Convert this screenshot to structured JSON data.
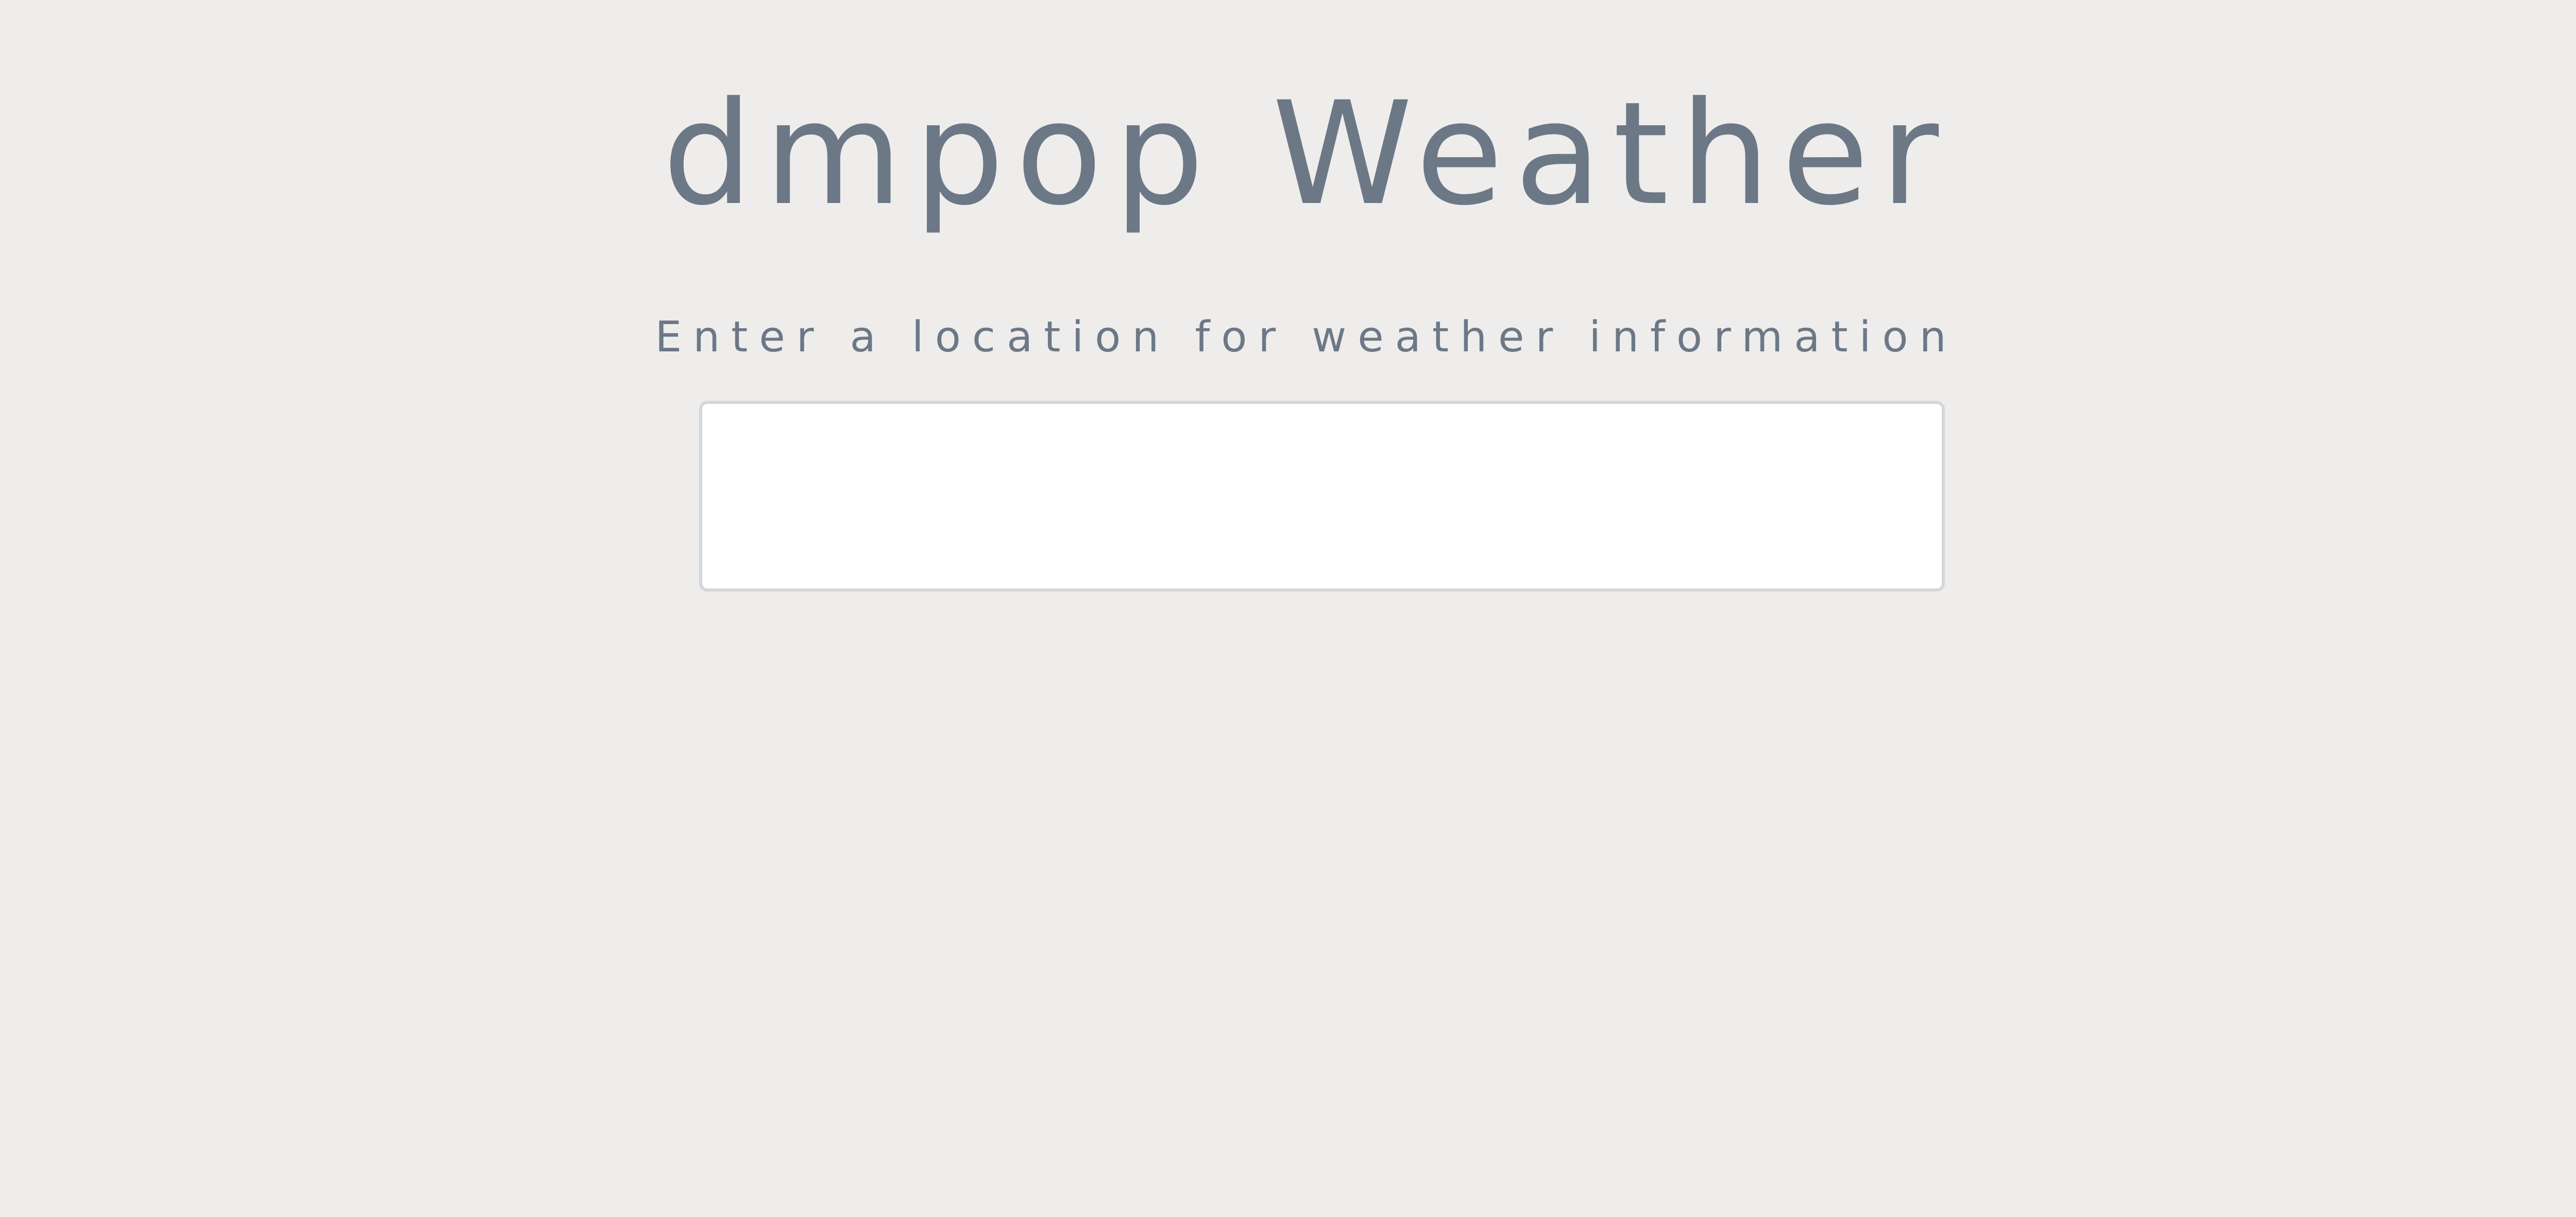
{
  "header": {
    "title": "dmpop Weather"
  },
  "search": {
    "prompt": "Enter a location for weather information",
    "value": "",
    "placeholder": ""
  },
  "colors": {
    "background": "#eeedec",
    "text": "#6c7886",
    "input_border": "#d3d7dc"
  }
}
